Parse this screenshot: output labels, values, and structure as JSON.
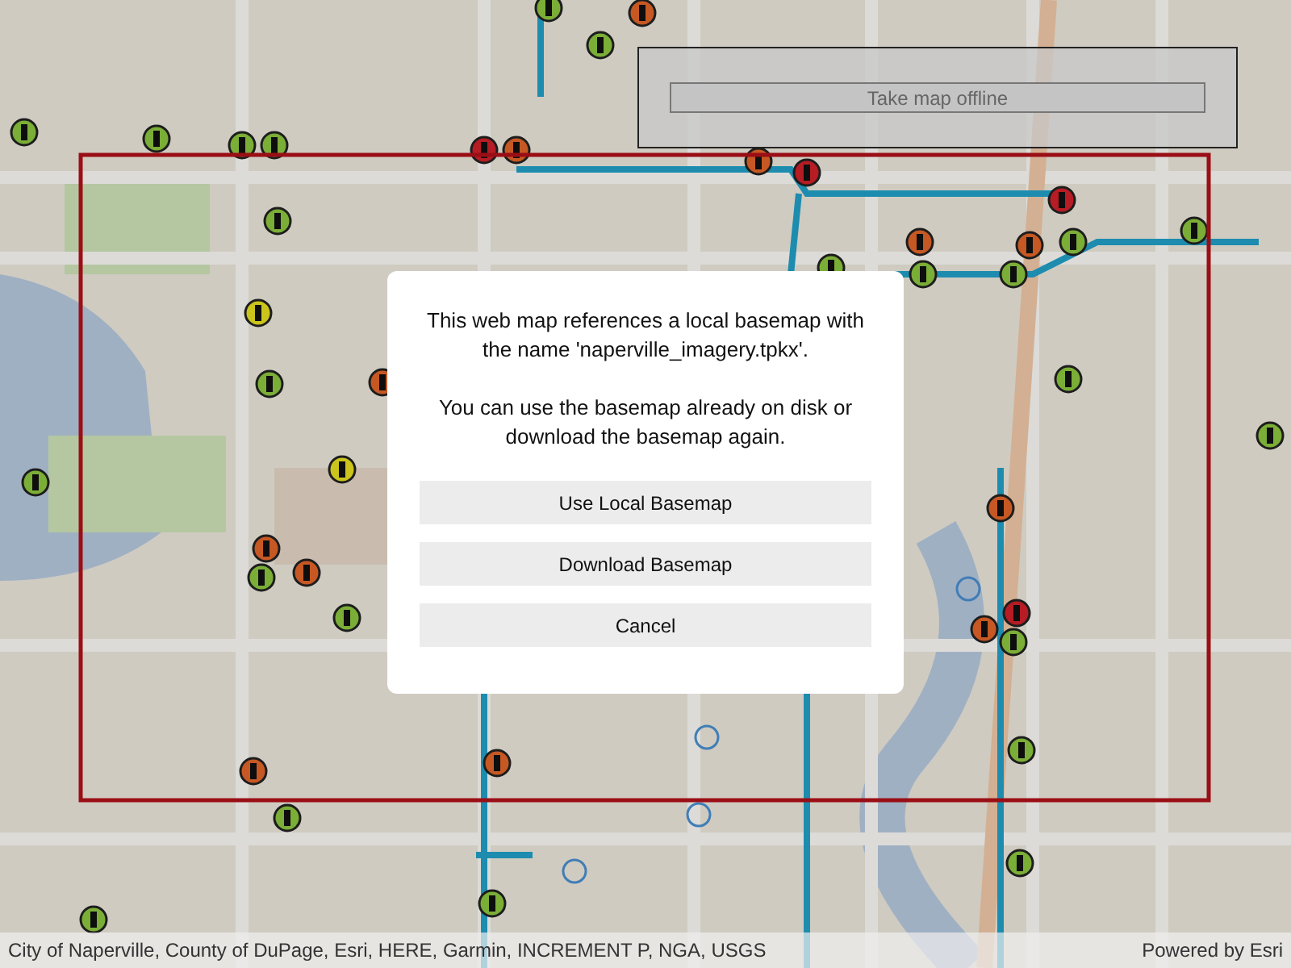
{
  "offline_panel": {
    "button": "Take map offline"
  },
  "dialog": {
    "message_lines": [
      "This web map references a local basemap with the name 'naperville_imagery.tpkx'.",
      "You can use the basemap already on disk or download the basemap again."
    ],
    "buttons": [
      "Use Local Basemap",
      "Download Basemap",
      "Cancel"
    ]
  },
  "attribution": {
    "sources": "City of Naperville, County of DuPage, Esri, HERE, Garmin, INCREMENT P, NGA, USGS",
    "powered_by": "Powered by Esri"
  }
}
